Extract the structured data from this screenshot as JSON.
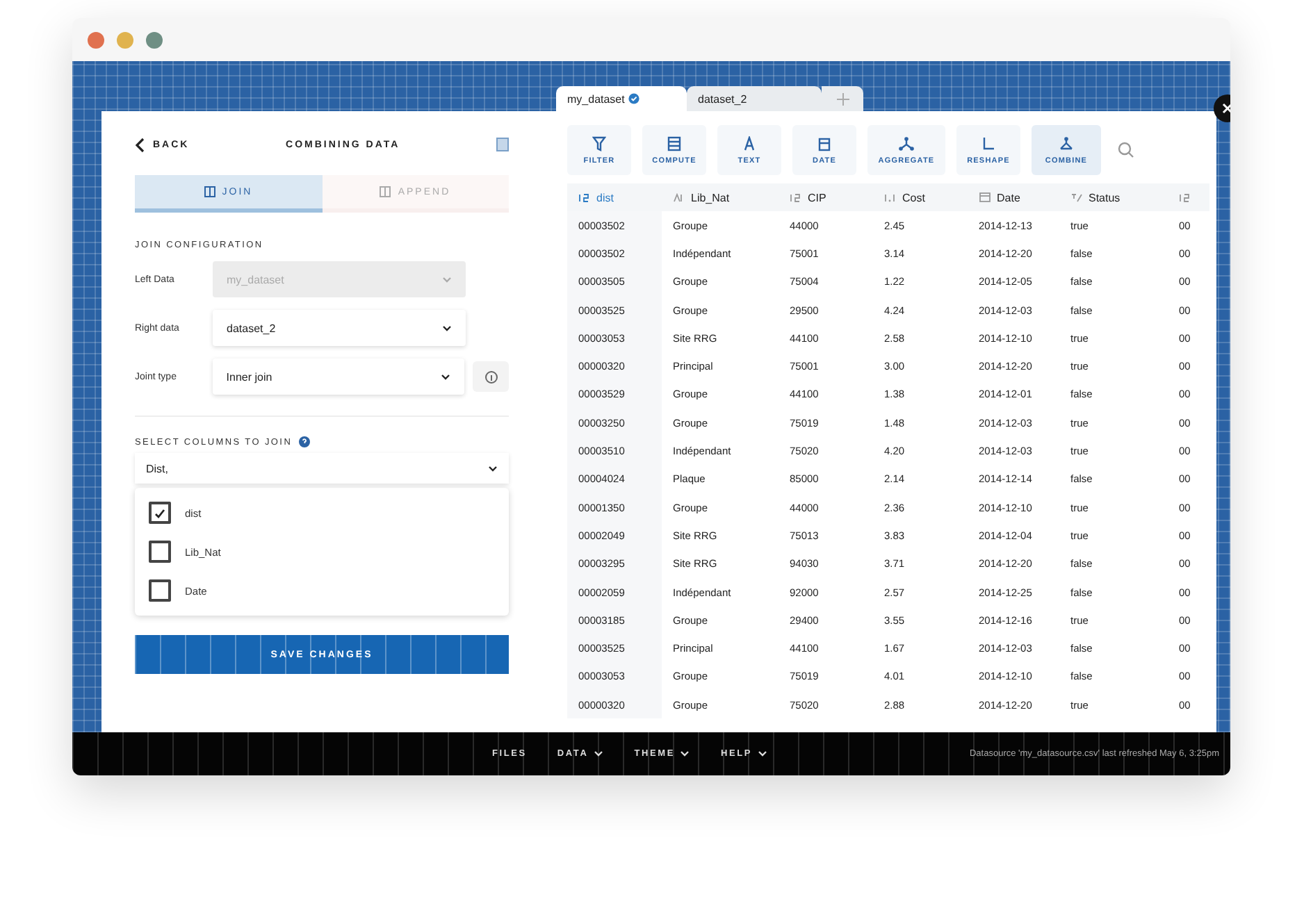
{
  "window": {
    "controls": [
      {
        "color": "#e0714f"
      },
      {
        "color": "#e0b34f"
      },
      {
        "color": "#6f8f84"
      }
    ]
  },
  "side_panel": {
    "back": "BACK",
    "title": "COMBINING DATA",
    "tabs": [
      {
        "label": "JOIN",
        "selected": true
      },
      {
        "label": "APPEND",
        "selected": false
      }
    ],
    "section_title": "JOIN CONFIGURATION",
    "fields": [
      {
        "label": "Left Data",
        "value": "my_dataset",
        "disabled": true,
        "info": false
      },
      {
        "label": "Right data",
        "value": "dataset_2",
        "disabled": false,
        "info": false
      },
      {
        "label": "Joint type",
        "value": "Inner join",
        "disabled": false,
        "info": true
      }
    ],
    "columns_title": "SELECT COLUMNS TO JOIN",
    "columns_select": {
      "value": "Dist,"
    },
    "options": [
      {
        "label": "dist",
        "checked": true
      },
      {
        "label": "Lib_Nat",
        "checked": false
      },
      {
        "label": "Date",
        "checked": false
      }
    ],
    "save": "SAVE CHANGES"
  },
  "dataset_tabs": [
    {
      "label": "my_dataset",
      "selected": true,
      "verified": true
    },
    {
      "label": "dataset_2",
      "selected": false,
      "verified": false
    }
  ],
  "toolbar": [
    {
      "label": "FILTER",
      "kind": "filter",
      "selected": false
    },
    {
      "label": "COMPUTE",
      "kind": "compute",
      "selected": false
    },
    {
      "label": "TEXT",
      "kind": "text",
      "selected": false
    },
    {
      "label": "DATE",
      "kind": "date",
      "selected": false
    },
    {
      "label": "AGGREGATE",
      "kind": "aggregate",
      "selected": false
    },
    {
      "label": "RESHAPE",
      "kind": "reshape",
      "selected": false
    },
    {
      "label": "COMBINE",
      "kind": "combine",
      "selected": true
    }
  ],
  "table": {
    "columns": [
      {
        "label": "dist",
        "kind": "number",
        "selected": true
      },
      {
        "label": "Lib_Nat",
        "kind": "text",
        "selected": false
      },
      {
        "label": "CIP",
        "kind": "number",
        "selected": false
      },
      {
        "label": "Cost",
        "kind": "decimal",
        "selected": false
      },
      {
        "label": "Date",
        "kind": "date",
        "selected": false
      },
      {
        "label": "Status",
        "kind": "boolean",
        "selected": false
      },
      {
        "kind": "number",
        "selected": false
      }
    ],
    "rows": [
      [
        "00003502",
        "Groupe",
        "44000",
        "2.45",
        "2014-12-13",
        "true",
        "00"
      ],
      [
        "00003502",
        "Indépendant",
        "75001",
        "3.14",
        "2014-12-20",
        "false",
        "00"
      ],
      [
        "00003505",
        "Groupe",
        "75004",
        "1.22",
        "2014-12-05",
        "false",
        "00"
      ],
      [
        "00003525",
        "Groupe",
        "29500",
        "4.24",
        "2014-12-03",
        "false",
        "00"
      ],
      [
        "00003053",
        "Site RRG",
        "44100",
        "2.58",
        "2014-12-10",
        "true",
        "00"
      ],
      [
        "00000320",
        "Principal",
        "75001",
        "3.00",
        "2014-12-20",
        "true",
        "00"
      ],
      [
        "00003529",
        "Groupe",
        "44100",
        "1.38",
        "2014-12-01",
        "false",
        "00"
      ],
      [
        "00003250",
        "Groupe",
        "75019",
        "1.48",
        "2014-12-03",
        "true",
        "00"
      ],
      [
        "00003510",
        "Indépendant",
        "75020",
        "4.20",
        "2014-12-03",
        "true",
        "00"
      ],
      [
        "00004024",
        "Plaque",
        "85000",
        "2.14",
        "2014-12-14",
        "false",
        "00"
      ],
      [
        "00001350",
        "Groupe",
        "44000",
        "2.36",
        "2014-12-10",
        "true",
        "00"
      ],
      [
        "00002049",
        "Site RRG",
        "75013",
        "3.83",
        "2014-12-04",
        "true",
        "00"
      ],
      [
        "00003295",
        "Site RRG",
        "94030",
        "3.71",
        "2014-12-20",
        "false",
        "00"
      ],
      [
        "00002059",
        "Indépendant",
        "92000",
        "2.57",
        "2014-12-25",
        "false",
        "00"
      ],
      [
        "00003185",
        "Groupe",
        "29400",
        "3.55",
        "2014-12-16",
        "true",
        "00"
      ],
      [
        "00003525",
        "Principal",
        "44100",
        "1.67",
        "2014-12-03",
        "false",
        "00"
      ],
      [
        "00003053",
        "Groupe",
        "75019",
        "4.01",
        "2014-12-10",
        "false",
        "00"
      ],
      [
        "00000320",
        "Groupe",
        "75020",
        "2.88",
        "2014-12-20",
        "true",
        "00"
      ]
    ]
  },
  "footer": {
    "menus": [
      {
        "label": "FILES",
        "dropdown": false
      },
      {
        "label": "DATA",
        "dropdown": true
      },
      {
        "label": "THEME",
        "dropdown": true
      },
      {
        "label": "HELP",
        "dropdown": true
      }
    ],
    "status": "Datasource 'my_datasource.csv' last refreshed May 6, 3:25pm"
  }
}
